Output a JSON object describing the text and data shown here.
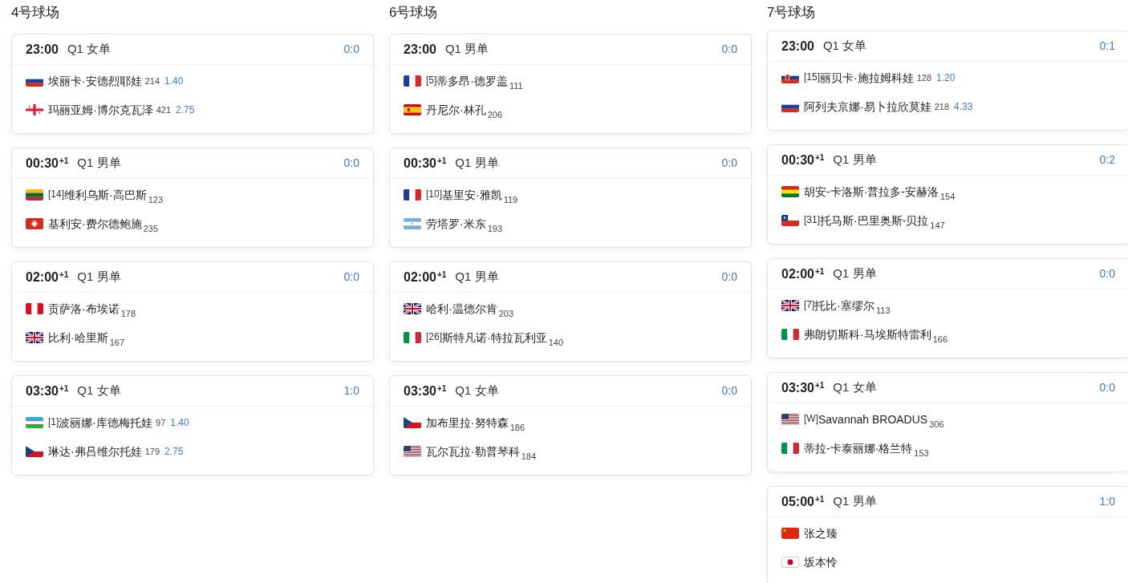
{
  "courts": [
    {
      "name": "4号球场",
      "matches": [
        {
          "time": "23:00",
          "round": "Q1 女单",
          "score": "0:0",
          "players": [
            {
              "kind": "ru",
              "name": "埃丽卡·安德烈耶娃",
              "rank": "214",
              "odds": "1.40"
            },
            {
              "kind": "ge",
              "name": "玛丽亚姆·博尔克瓦泽",
              "rank": "421",
              "odds": "2.75"
            }
          ]
        },
        {
          "time": "00:30",
          "day_offset": "+1",
          "round": "Q1 男单",
          "score": "0:0",
          "players": [
            {
              "kind": "lt",
              "seed": "[14]",
              "name": "维利乌斯·高巴斯",
              "rank": "123"
            },
            {
              "kind": "ch",
              "name": "基利安·费尔德鲍施",
              "rank": "235"
            }
          ]
        },
        {
          "time": "02:00",
          "day_offset": "+1",
          "round": "Q1 男单",
          "score": "0:0",
          "players": [
            {
              "kind": "pe",
              "name": "贡萨洛·布埃诺",
              "rank": "178"
            },
            {
              "kind": "gb",
              "name": "比利·哈里斯",
              "rank": "167"
            }
          ]
        },
        {
          "time": "03:30",
          "day_offset": "+1",
          "round": "Q1 女单",
          "score": "1:0",
          "players": [
            {
              "kind": "uz",
              "seed": "[1]",
              "name": "波丽娜·库德梅托娃",
              "rank": "97",
              "odds": "1.40"
            },
            {
              "kind": "cz",
              "name": "琳达·弗吕维尔托娃",
              "rank": "179",
              "odds": "2.75"
            }
          ]
        }
      ]
    },
    {
      "name": "6号球场",
      "matches": [
        {
          "time": "23:00",
          "round": "Q1 男单",
          "score": "0:0",
          "players": [
            {
              "kind": "fr",
              "seed": "[5]",
              "name": "蒂多昂·德罗盖",
              "rank": "111"
            },
            {
              "kind": "es",
              "name": "丹尼尔·林孔",
              "rank": "206"
            }
          ]
        },
        {
          "time": "00:30",
          "day_offset": "+1",
          "round": "Q1 男单",
          "score": "0:0",
          "players": [
            {
              "kind": "fr",
              "seed": "[10]",
              "name": "基里安·雅凯",
              "rank": "119"
            },
            {
              "kind": "ar",
              "name": "劳塔罗·米东",
              "rank": "193"
            }
          ]
        },
        {
          "time": "02:00",
          "day_offset": "+1",
          "round": "Q1 男单",
          "score": "0:0",
          "players": [
            {
              "kind": "gb",
              "name": "哈利·温德尔肯",
              "rank": "203"
            },
            {
              "kind": "it",
              "seed": "[26]",
              "name": "斯特凡诺·特拉瓦利亚",
              "rank": "140"
            }
          ]
        },
        {
          "time": "03:30",
          "day_offset": "+1",
          "round": "Q1 女单",
          "score": "0:0",
          "players": [
            {
              "kind": "cz",
              "name": "加布里拉·努特森",
              "rank": "186"
            },
            {
              "kind": "us",
              "name": "瓦尔瓦拉·勒普琴科",
              "rank": "184"
            }
          ]
        }
      ]
    },
    {
      "name": "7号球场",
      "matches": [
        {
          "time": "23:00",
          "round": "Q1 女单",
          "score": "0:1",
          "players": [
            {
              "kind": "sk",
              "seed": "[15]",
              "name": "丽贝卡·施拉姆科娃",
              "rank": "128",
              "odds": "1.20"
            },
            {
              "kind": "ru",
              "name": "阿列夫京娜·易卜拉欣莫娃",
              "rank": "218",
              "odds": "4.33"
            }
          ]
        },
        {
          "time": "00:30",
          "day_offset": "+1",
          "round": "Q1 男单",
          "score": "0:2",
          "players": [
            {
              "kind": "bo",
              "name": "胡安-卡洛斯·普拉多-安赫洛",
              "rank": "154"
            },
            {
              "kind": "cl",
              "seed": "[31]",
              "name": "托马斯·巴里奥斯-贝拉",
              "rank": "147"
            }
          ]
        },
        {
          "time": "02:00",
          "day_offset": "+1",
          "round": "Q1 男单",
          "score": "0:0",
          "players": [
            {
              "kind": "gb",
              "seed": "[7]",
              "name": "托比·塞缪尔",
              "rank": "113"
            },
            {
              "kind": "it",
              "name": "弗朗切斯科·马埃斯特雷利",
              "rank": "166"
            }
          ]
        },
        {
          "time": "03:30",
          "day_offset": "+1",
          "round": "Q1 女单",
          "score": "0:0",
          "players": [
            {
              "kind": "us",
              "seed": "[W]",
              "name": "Savannah BROADUS",
              "rank": "306"
            },
            {
              "kind": "it",
              "name": "蒂拉-卡泰丽娜·格兰特",
              "rank": "153"
            }
          ]
        },
        {
          "time": "05:00",
          "day_offset": "+1",
          "round": "Q1 男单",
          "score": "1:0",
          "players": [
            {
              "kind": "cn",
              "name": "张之臻"
            },
            {
              "kind": "jp",
              "name": "坂本怜"
            }
          ]
        }
      ]
    }
  ]
}
